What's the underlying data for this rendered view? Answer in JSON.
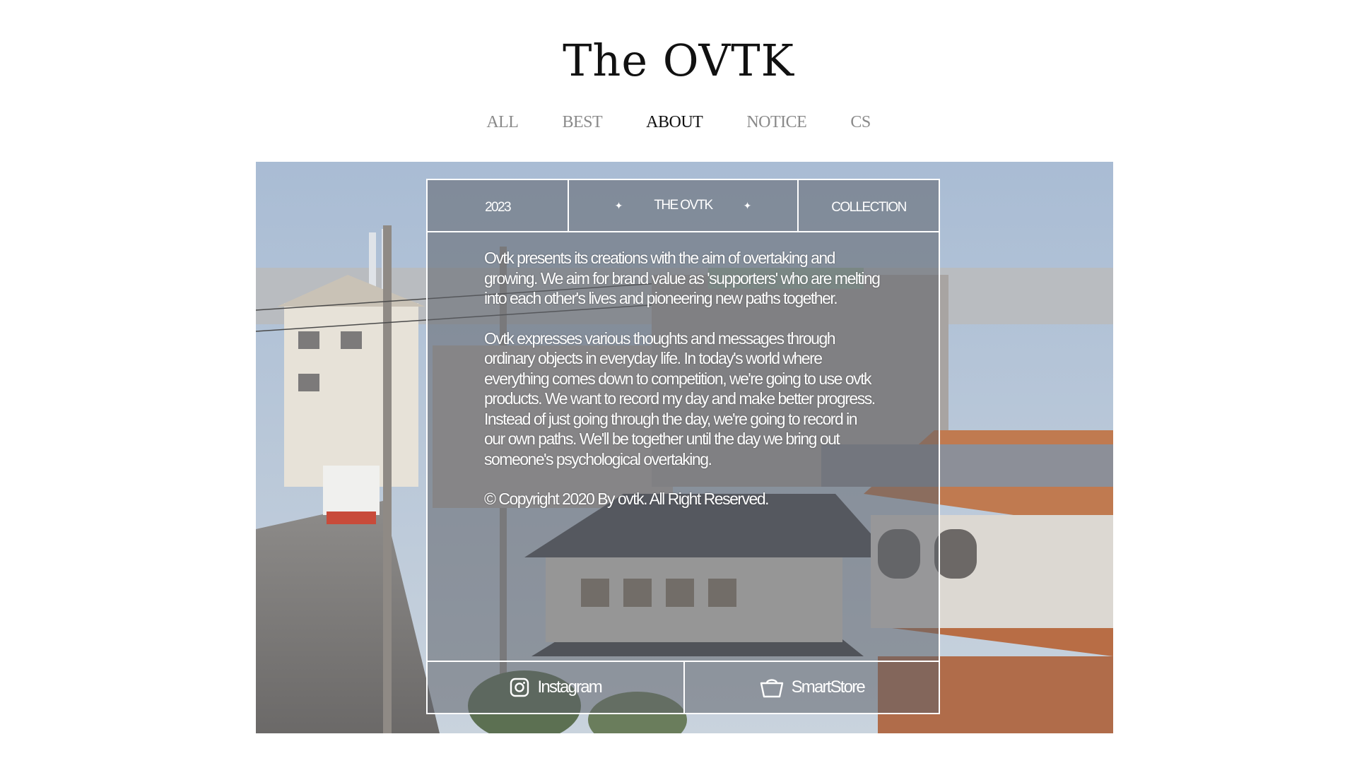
{
  "brand": {
    "logo_text": "The OVTK"
  },
  "nav": {
    "items": [
      {
        "label": "ALL"
      },
      {
        "label": "BEST"
      },
      {
        "label": "ABOUT",
        "active": true
      },
      {
        "label": "NOTICE"
      },
      {
        "label": "CS"
      }
    ]
  },
  "hero": {
    "image_subject": "residential street rooftops photo"
  },
  "panel": {
    "header": {
      "year": "2023",
      "brand": "THE OVTK",
      "sparkle_icon": "four-point-star-icon",
      "collection": "COLLECTION"
    },
    "paragraphs": [
      "Ovtk presents its creations with the aim of overtaking and growing. We aim for brand value as 'supporters' who are melting into each other's lives and pioneering new paths together.",
      "Ovtk expresses various thoughts and messages through ordinary objects in everyday life. In today's world where everything comes down to competition, we're going to use ovtk products. We want to record my day and make better progress. Instead of just going through the day, we're going to record in our own paths. We'll be together until the day we bring out someone's psychological overtaking.",
      "© Copyright 2020 By ovtk. All Right Reserved."
    ],
    "links": {
      "instagram": {
        "label": "Instagram",
        "icon": "instagram-icon"
      },
      "smartstore": {
        "label": "SmartStore",
        "icon": "shopping-basket-icon"
      }
    }
  },
  "colors": {
    "nav_inactive": "#8a8a8a",
    "nav_active": "#111111",
    "panel_border": "#ffffff"
  }
}
